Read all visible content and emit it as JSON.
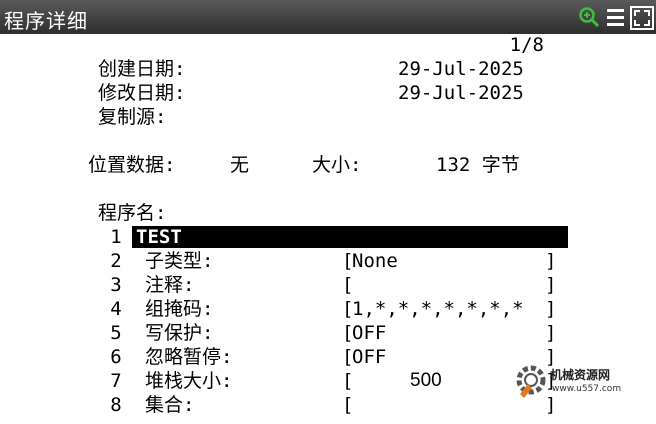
{
  "window": {
    "title": "程序详细"
  },
  "toolbar": {
    "icons": [
      "zoom-icon",
      "menu-icon",
      "fullscreen-icon"
    ]
  },
  "page_indicator": "1/8",
  "header": {
    "created_label": "创建日期:",
    "created_value": "29-Jul-2025",
    "modified_label": "修改日期:",
    "modified_value": "29-Jul-2025",
    "copy_source_label": "复制源:",
    "position_data_label": "位置数据:",
    "position_data_value": "无",
    "size_label": "大小:",
    "size_value": "132 字节"
  },
  "program": {
    "section_label": "程序名:",
    "rows": [
      {
        "num": "1",
        "label": "TEST",
        "value": ""
      },
      {
        "num": "2",
        "label": "子类型:",
        "value": "None"
      },
      {
        "num": "3",
        "label": "注释:",
        "value": ""
      },
      {
        "num": "4",
        "label": "组掩码:",
        "value": "1,*,*,*,*,*,*,*"
      },
      {
        "num": "5",
        "label": "写保护:",
        "value": "OFF"
      },
      {
        "num": "6",
        "label": "忽略暂停:",
        "value": "OFF"
      },
      {
        "num": "7",
        "label": "堆栈大小:",
        "value": "500"
      },
      {
        "num": "8",
        "label": "集合:",
        "value": ""
      }
    ],
    "bracket_open": "[",
    "bracket_close": "]"
  },
  "watermark": {
    "name": "机械资源网",
    "url": "www.u557.com"
  },
  "colors": {
    "titlebar": "#3c3c3c",
    "zoom_icon": "#3fbf3f",
    "selection": "#000000"
  }
}
